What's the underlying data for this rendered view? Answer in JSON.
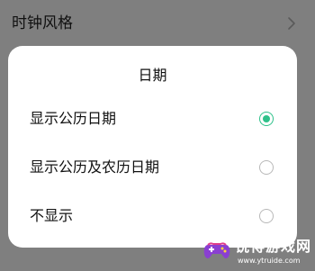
{
  "background": {
    "setting_title": "时钟风格",
    "chevron_icon": "chevron-right-icon"
  },
  "dialog": {
    "title": "日期",
    "options": [
      {
        "label": "显示公历日期",
        "selected": true
      },
      {
        "label": "显示公历及农历日期",
        "selected": false
      },
      {
        "label": "不显示",
        "selected": false
      }
    ],
    "accent_color": "#2fc18a"
  },
  "watermark": {
    "title": "锐得游戏网",
    "url": "www.ytruide.com",
    "logo_icon": "game-controller-icon"
  }
}
